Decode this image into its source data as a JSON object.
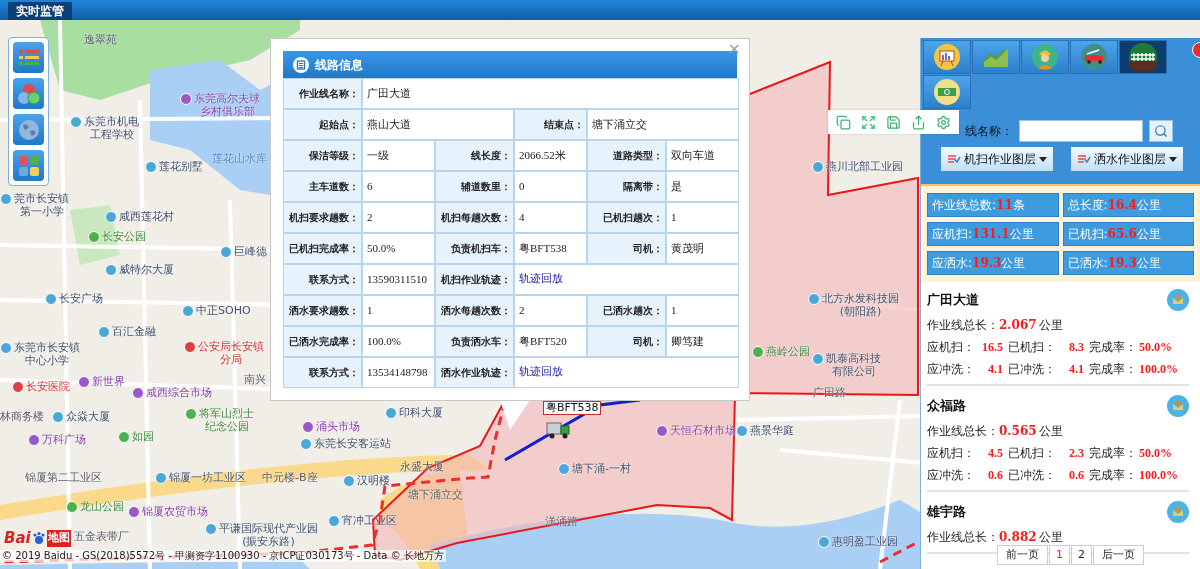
{
  "top_bar": {
    "tabs": [
      {
        "label": "实时监管",
        "selected": true
      }
    ]
  },
  "map": {
    "labels": [
      {
        "lines": [
          "逸翠苑"
        ],
        "kind": "plain"
      },
      {
        "lines": [
          "东莞高尔夫球",
          "乡村俱乐部"
        ],
        "kind": "market"
      },
      {
        "lines": [
          "东莞市机电",
          "工程学校"
        ],
        "kind": "building"
      },
      {
        "lines": [
          "莲花别墅"
        ],
        "kind": "building"
      },
      {
        "lines": [
          "莲花山水库"
        ],
        "kind": "water"
      },
      {
        "lines": [
          "莞市长安镇",
          "第一小学"
        ],
        "kind": "building"
      },
      {
        "lines": [
          "咸西莲花村"
        ],
        "kind": "building"
      },
      {
        "lines": [
          "长安公园"
        ],
        "kind": "park"
      },
      {
        "lines": [
          "巨峰德"
        ],
        "kind": "building"
      },
      {
        "lines": [
          "威特尔大厦"
        ],
        "kind": "building"
      },
      {
        "lines": [
          "长安广场"
        ],
        "kind": "building"
      },
      {
        "lines": [
          "中正SOHO"
        ],
        "kind": "building"
      },
      {
        "lines": [
          "百汇金融"
        ],
        "kind": "building"
      },
      {
        "lines": [
          "东莞市长安镇",
          "中心小学"
        ],
        "kind": "building"
      },
      {
        "lines": [
          "公安局长安镇",
          "分局"
        ],
        "kind": "official"
      },
      {
        "lines": [
          "长安医院"
        ],
        "kind": "official"
      },
      {
        "lines": [
          "新世界"
        ],
        "kind": "market"
      },
      {
        "lines": [
          "咸西综合市场"
        ],
        "kind": "market"
      },
      {
        "lines": [
          "南兴"
        ],
        "kind": "plain"
      },
      {
        "lines": [
          "林商务楼"
        ],
        "kind": "plain"
      },
      {
        "lines": [
          "众焱大厦"
        ],
        "kind": "building"
      },
      {
        "lines": [
          "将军山烈士",
          "纪念公园"
        ],
        "kind": "park"
      },
      {
        "lines": [
          "万科广场"
        ],
        "kind": "market"
      },
      {
        "lines": [
          "如园"
        ],
        "kind": "park"
      },
      {
        "lines": [
          "锦厦第二工业区"
        ],
        "kind": "plain"
      },
      {
        "lines": [
          "锦厦一坊工业区"
        ],
        "kind": "building"
      },
      {
        "lines": [
          "中元楼-B座"
        ],
        "kind": "plain"
      },
      {
        "lines": [
          "龙山公园"
        ],
        "kind": "park"
      },
      {
        "lines": [
          "锦厦农贸市场"
        ],
        "kind": "market"
      },
      {
        "lines": [
          "五金表带厂"
        ],
        "kind": "plain"
      },
      {
        "lines": [
          "平谦国际现代产业园",
          "(振安东路)"
        ],
        "kind": "building"
      },
      {
        "lines": [
          "燕川北部工业园"
        ],
        "kind": "building"
      },
      {
        "lines": [
          "北方永发科技园",
          "(朝阳路)"
        ],
        "kind": "building"
      },
      {
        "lines": [
          "燕岭公园"
        ],
        "kind": "park"
      },
      {
        "lines": [
          "凯泰高科技",
          "有限公司"
        ],
        "kind": "building"
      },
      {
        "lines": [
          "广田路"
        ],
        "kind": "road"
      },
      {
        "lines": [
          "印科大厦"
        ],
        "kind": "building"
      },
      {
        "lines": [
          "涌头市场"
        ],
        "kind": "market"
      },
      {
        "lines": [
          "天恒石材市场"
        ],
        "kind": "market"
      },
      {
        "lines": [
          "燕景华庭"
        ],
        "kind": "building"
      },
      {
        "lines": [
          "东莞长安客运站"
        ],
        "kind": "building"
      },
      {
        "lines": [
          "永盛大厦"
        ],
        "kind": "plain"
      },
      {
        "lines": [
          "塘下涌-一村"
        ],
        "kind": "building"
      },
      {
        "lines": [
          "汉明楼"
        ],
        "kind": "building"
      },
      {
        "lines": [
          "塘下涌立交"
        ],
        "kind": "plain"
      },
      {
        "lines": [
          "宵冲工业区"
        ],
        "kind": "building"
      },
      {
        "lines": [
          "洋涌路"
        ],
        "kind": "road"
      },
      {
        "lines": [
          "惠明盈工业园"
        ],
        "kind": "building"
      }
    ],
    "vehicle": {
      "plate": "粤BFT538"
    },
    "logo": {
      "left": "Bai",
      "right": "地图"
    },
    "copyright": "© 2019 Baidu - GS(2018)5572号 - 甲测资字1100930 - 京ICP证030173号 - Data © 长地万方"
  },
  "popup": {
    "title": "线路信息",
    "close": "×",
    "rows": [
      {
        "kind": "full",
        "fields": [
          {
            "label": "作业线名称：",
            "value": "广田大道"
          }
        ]
      },
      {
        "kind": "halves",
        "fields": [
          {
            "label": "起始点：",
            "value": "燕山大道"
          },
          {
            "label": "结束点：",
            "value": "塘下涌立交"
          }
        ]
      },
      {
        "kind": "thirds",
        "fields": [
          {
            "label": "保洁等级：",
            "value": "一级"
          },
          {
            "label": "线长度：",
            "value": "2066.52米"
          },
          {
            "label": "道路类型：",
            "value": "双向车道"
          }
        ]
      },
      {
        "kind": "thirds",
        "fields": [
          {
            "label": "主车道数：",
            "value": "6"
          },
          {
            "label": "辅道数里：",
            "value": "0"
          },
          {
            "label": "隔离带：",
            "value": "是"
          }
        ]
      },
      {
        "kind": "thirds",
        "fields": [
          {
            "label": "机扫要求趟数：",
            "value": "2"
          },
          {
            "label": "机扫每趟次数：",
            "value": "4"
          },
          {
            "label": "已机扫趟次：",
            "value": "1"
          }
        ]
      },
      {
        "kind": "thirds",
        "fields": [
          {
            "label": "已机扫完成率：",
            "value": "50.0%"
          },
          {
            "label": "负责机扫车：",
            "value": "粤BFT538"
          },
          {
            "label": "司机：",
            "value": "黄茂明"
          }
        ]
      },
      {
        "kind": "contact",
        "fields": [
          {
            "label": "联系方式：",
            "value": "13590311510"
          },
          {
            "label": "机扫作业轨迹：",
            "value": "轨迹回放",
            "link": true
          }
        ]
      },
      {
        "kind": "thirds",
        "fields": [
          {
            "label": "洒水要求趟数：",
            "value": "1"
          },
          {
            "label": "洒水每趟次数：",
            "value": "2"
          },
          {
            "label": "已洒水趟次：",
            "value": "1"
          }
        ]
      },
      {
        "kind": "thirds",
        "fields": [
          {
            "label": "已洒水完成率：",
            "value": "100.0%"
          },
          {
            "label": "负责洒水车：",
            "value": "粤BFT520"
          },
          {
            "label": "司机：",
            "value": "卿笃建"
          }
        ]
      },
      {
        "kind": "contact",
        "fields": [
          {
            "label": "联系方式：",
            "value": "13534148798"
          },
          {
            "label": "洒水作业轨迹：",
            "value": "轨迹回放",
            "link": true
          }
        ]
      }
    ]
  },
  "panel": {
    "tabs": [
      {
        "kind": "chart",
        "selected": false
      },
      {
        "kind": "trend",
        "selected": false
      },
      {
        "kind": "worker",
        "selected": false
      },
      {
        "kind": "truck",
        "selected": false
      },
      {
        "kind": "fence",
        "selected": true
      },
      {
        "kind": "money",
        "selected": false
      }
    ],
    "search": {
      "label": "线名称："
    },
    "layers": [
      "机扫作业图层",
      "洒水作业图层"
    ],
    "stats": [
      {
        "label": "作业线总数:",
        "value": "11",
        "unit": "条"
      },
      {
        "label": "总长度:",
        "value": "16.4",
        "unit": "公里"
      },
      {
        "label": "应机扫:",
        "value": "131.1",
        "unit": "公里"
      },
      {
        "label": "已机扫:",
        "value": "65.6",
        "unit": "公里"
      },
      {
        "label": "应洒水:",
        "value": "19.3",
        "unit": "公里"
      },
      {
        "label": "已洒水:",
        "value": "19.3",
        "unit": "公里"
      }
    ],
    "lines": [
      {
        "name": "广田大道",
        "total_label": "作业线总长：",
        "total": "2.067",
        "unit": "公里",
        "rows": [
          [
            {
              "label": "应机扫：",
              "value": "16.5"
            },
            {
              "label": "已机扫：",
              "value": "8.3"
            },
            {
              "label": "完成率：",
              "value": "50.0%"
            }
          ],
          [
            {
              "label": "应冲洗：",
              "value": "4.1"
            },
            {
              "label": "已冲洗：",
              "value": "4.1"
            },
            {
              "label": "完成率：",
              "value": "100.0%"
            }
          ]
        ]
      },
      {
        "name": "众福路",
        "total_label": "作业线总长：",
        "total": "0.565",
        "unit": "公里",
        "rows": [
          [
            {
              "label": "应机扫：",
              "value": "4.5"
            },
            {
              "label": "已机扫：",
              "value": "2.3"
            },
            {
              "label": "完成率：",
              "value": "50.0%"
            }
          ],
          [
            {
              "label": "应冲洗：",
              "value": "0.6"
            },
            {
              "label": "已冲洗：",
              "value": "0.6"
            },
            {
              "label": "完成率：",
              "value": "100.0%"
            }
          ]
        ]
      },
      {
        "name": "雄宇路",
        "total_label": "作业线总长：",
        "total": "0.882",
        "unit": "公里"
      }
    ],
    "pager": [
      {
        "label": "前一页",
        "kind": "nav",
        "selected": false
      },
      {
        "label": "1",
        "kind": "page",
        "selected": true
      },
      {
        "label": "2",
        "kind": "page",
        "selected": false
      },
      {
        "label": "后一页",
        "kind": "nav",
        "selected": false
      }
    ]
  }
}
